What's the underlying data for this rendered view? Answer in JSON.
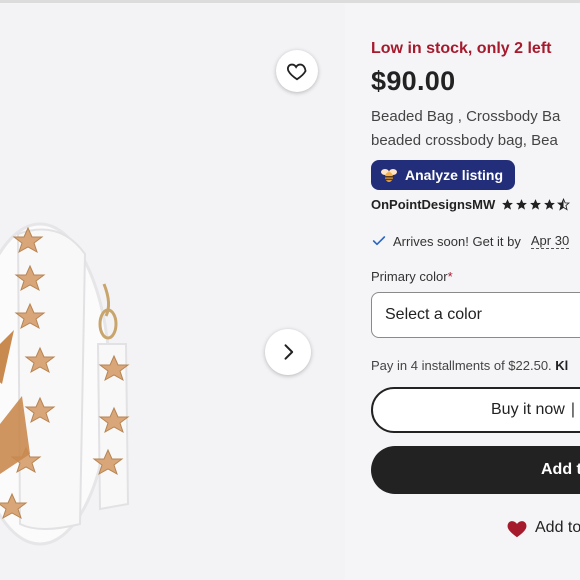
{
  "gallery": {
    "favorite_icon": "heart-outline-icon",
    "next_icon": "chevron-right-icon"
  },
  "listing": {
    "stock_notice": "Low in stock, only 2 left",
    "price": "$90.00",
    "title_line1": "Beaded Bag , Crossbody Ba",
    "title_line2": "beaded crossbody bag, Bea",
    "analyze_label": "Analyze listing",
    "shop_name": "OnPointDesignsMW",
    "rating_stars": 4.5,
    "arrival_text": "Arrives soon! Get it by",
    "arrival_date": "Apr 30",
    "color_label": "Primary color",
    "color_required_mark": "*",
    "color_placeholder": "Select a color",
    "installments_text": "Pay in 4 installments of $22.50.",
    "installments_brand": "Kl",
    "buy_now_label": "Buy it now",
    "buy_now_sep": "|",
    "add_to_cart_label": "Add t",
    "add_to_collection_label": "Add to"
  },
  "colors": {
    "stock_red": "#a61a2e",
    "analyze_bg": "#222e7a",
    "cart_bg": "#222222",
    "heart_red": "#a61a2e",
    "check_blue": "#2b66c4"
  }
}
